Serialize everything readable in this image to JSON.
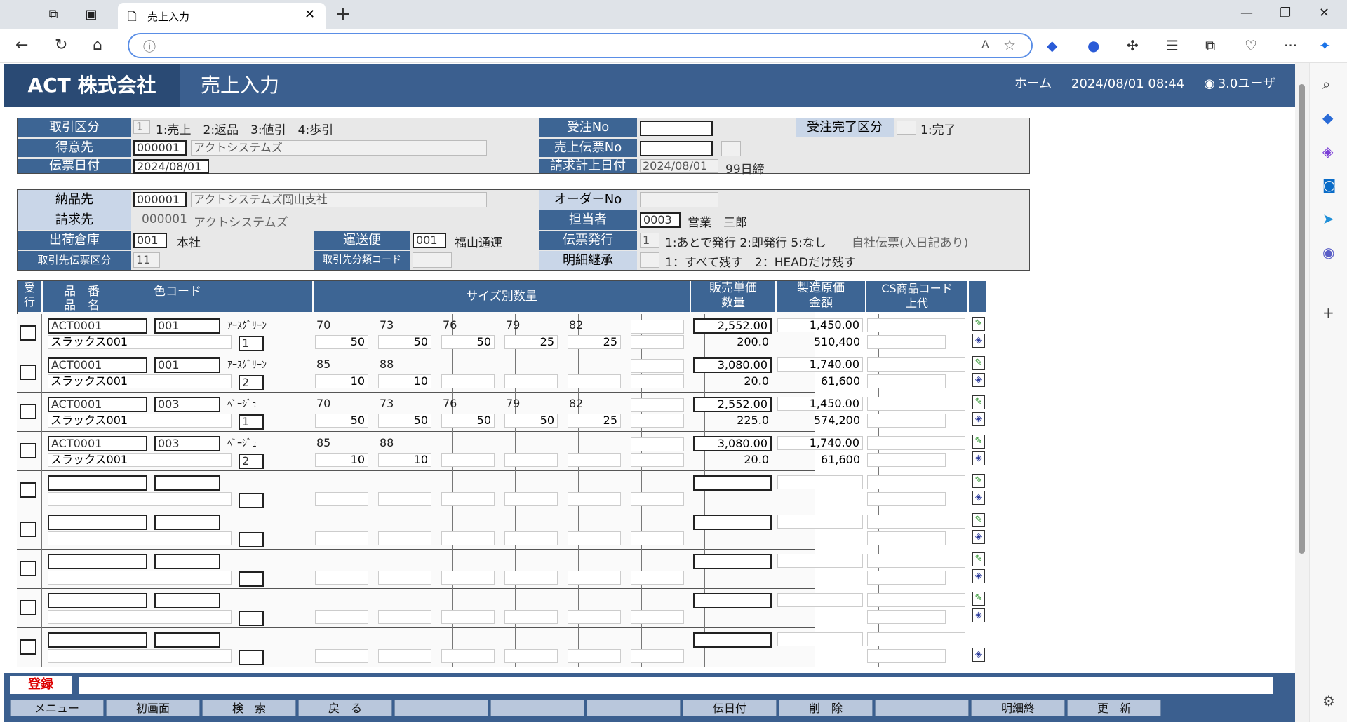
{
  "browser": {
    "tab_title": "売上入力"
  },
  "header": {
    "company": "ACT 株式会社",
    "title": "売上入力",
    "home": "ホーム",
    "datetime": "2024/08/01 08:44",
    "user": "3.0ユーザ"
  },
  "form": {
    "torihiki_kubun_label": "取引区分",
    "torihiki_kubun_value": "1",
    "torihiki_kubun_options": "1:売上　2:返品　3:値引　4:歩引",
    "juchu_no_label": "受注No",
    "juchu_kanryo_label": "受注完了区分",
    "juchu_kanryo_options": "1:完了",
    "tokuisaki_label": "得意先",
    "tokuisaki_code": "000001",
    "tokuisaki_name": "アクトシステムズ",
    "uriage_denpyo_label": "売上伝票No",
    "denpyo_date_label": "伝票日付",
    "denpyo_date": "2024/08/01",
    "seikyu_date_label": "請求計上日付",
    "seikyu_date": "2024/08/01",
    "shime": "99日締",
    "nohinsaki_label": "納品先",
    "nohinsaki_code": "000001",
    "nohinsaki_name": "アクトシステムズ岡山支社",
    "order_no_label": "オーダーNo",
    "seikyusaki_label": "請求先",
    "seikyusaki_code": "000001",
    "seikyusaki_name": "アクトシステムズ",
    "tantosha_label": "担当者",
    "tantosha_code": "0003",
    "tantosha_name": "営業　三郎",
    "soko_label": "出荷倉庫",
    "soko_code": "001",
    "soko_name": "本社",
    "unsobin_label": "運送便",
    "unsobin_code": "001",
    "unsobin_name": "福山通運",
    "denpyo_hakko_label": "伝票発行",
    "denpyo_hakko_value": "1",
    "denpyo_hakko_options": "1:あとで発行 2:即発行 5:なし",
    "jisha_denpyo": "自社伝票(入日記あり)",
    "torihikisaki_denpyo_label": "取引先伝票区分",
    "torihikisaki_denpyo_value": "11",
    "torihikisaki_bunrui_label": "取引先分類コード",
    "meisai_label": "明細継承",
    "meisai_options": "1：すべて残す　2：HEADだけ残す"
  },
  "grid": {
    "headers": {
      "uke": "受",
      "gyo": "行",
      "hinban": "品　番",
      "hinmei": "品　名",
      "color": "色コード",
      "size": "サイズ別数量",
      "tanka": "販売単価",
      "suryo": "数量",
      "genka": "製造原価",
      "kingaku": "金額",
      "cs": "CS商品コード",
      "jodai": "上代"
    },
    "rows": [
      {
        "hinban": "ACT0001",
        "color_code": "001",
        "color_name": "ｱｰｽｸﾞﾘｰﾝ",
        "hinmei": "スラックス001",
        "pattern": "1",
        "sizes": [
          {
            "s": "70",
            "q": "50"
          },
          {
            "s": "73",
            "q": "50"
          },
          {
            "s": "76",
            "q": "50"
          },
          {
            "s": "79",
            "q": "25"
          },
          {
            "s": "82",
            "q": "25"
          }
        ],
        "tanka": "2,552.00",
        "suryo": "200.0",
        "genka": "1,450.00",
        "kingaku": "510,400"
      },
      {
        "hinban": "ACT0001",
        "color_code": "001",
        "color_name": "ｱｰｽｸﾞﾘｰﾝ",
        "hinmei": "スラックス001",
        "pattern": "2",
        "sizes": [
          {
            "s": "85",
            "q": "10"
          },
          {
            "s": "88",
            "q": "10"
          }
        ],
        "tanka": "3,080.00",
        "suryo": "20.0",
        "genka": "1,740.00",
        "kingaku": "61,600"
      },
      {
        "hinban": "ACT0001",
        "color_code": "003",
        "color_name": "ﾍﾞｰｼﾞｭ",
        "hinmei": "スラックス001",
        "pattern": "1",
        "sizes": [
          {
            "s": "70",
            "q": "50"
          },
          {
            "s": "73",
            "q": "50"
          },
          {
            "s": "76",
            "q": "50"
          },
          {
            "s": "79",
            "q": "50"
          },
          {
            "s": "82",
            "q": "25"
          }
        ],
        "tanka": "2,552.00",
        "suryo": "225.0",
        "genka": "1,450.00",
        "kingaku": "574,200"
      },
      {
        "hinban": "ACT0001",
        "color_code": "003",
        "color_name": "ﾍﾞｰｼﾞｭ",
        "hinmei": "スラックス001",
        "pattern": "2",
        "sizes": [
          {
            "s": "85",
            "q": "10"
          },
          {
            "s": "88",
            "q": "10"
          }
        ],
        "tanka": "3,080.00",
        "suryo": "20.0",
        "genka": "1,740.00",
        "kingaku": "61,600"
      },
      {},
      {},
      {},
      {},
      {}
    ]
  },
  "footer": {
    "mode": "登録",
    "keys": [
      "メニュー",
      "初画面",
      "検　索",
      "戻　る",
      "",
      "",
      "",
      "伝日付",
      "削　除",
      "",
      "明細終",
      "更　新"
    ]
  }
}
